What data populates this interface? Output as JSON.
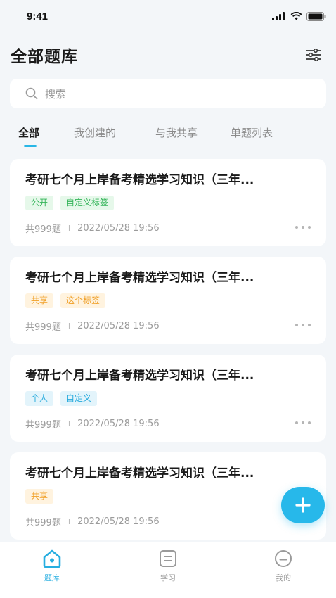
{
  "status_bar": {
    "time": "9:41"
  },
  "header": {
    "title": "全部题库"
  },
  "search": {
    "placeholder": "搜索"
  },
  "tabs": [
    {
      "label": "全部",
      "active": true
    },
    {
      "label": "我创建的",
      "active": false
    },
    {
      "label": "与我共享",
      "active": false
    },
    {
      "label": "单题列表",
      "active": false
    }
  ],
  "cards": [
    {
      "title": "考研七个月上岸备考精选学习知识（三年...",
      "tags": [
        {
          "label": "公开",
          "color": "green"
        },
        {
          "label": "自定义标签",
          "color": "green"
        }
      ],
      "count": "共999题",
      "separator": "I",
      "date": "2022/05/28 19:56"
    },
    {
      "title": "考研七个月上岸备考精选学习知识（三年...",
      "tags": [
        {
          "label": "共享",
          "color": "orange"
        },
        {
          "label": "这个标签",
          "color": "orange"
        }
      ],
      "count": "共999题",
      "separator": "I",
      "date": "2022/05/28 19:56"
    },
    {
      "title": "考研七个月上岸备考精选学习知识（三年...",
      "tags": [
        {
          "label": "个人",
          "color": "blue"
        },
        {
          "label": "自定义",
          "color": "blue"
        }
      ],
      "count": "共999题",
      "separator": "I",
      "date": "2022/05/28 19:56"
    },
    {
      "title": "考研七个月上岸备考精选学习知识（三年...",
      "tags": [
        {
          "label": "共享",
          "color": "orange"
        }
      ],
      "count": "共999题",
      "separator": "I",
      "date": "2022/05/28 19:56"
    }
  ],
  "fab": {
    "icon": "plus-icon"
  },
  "tabbar": [
    {
      "label": "题库",
      "icon": "home-icon",
      "active": true
    },
    {
      "label": "学习",
      "icon": "study-icon",
      "active": false
    },
    {
      "label": "我的",
      "icon": "profile-icon",
      "active": false
    }
  ],
  "colors": {
    "accent": "#27b8ea",
    "background": "#f3f6f9"
  }
}
